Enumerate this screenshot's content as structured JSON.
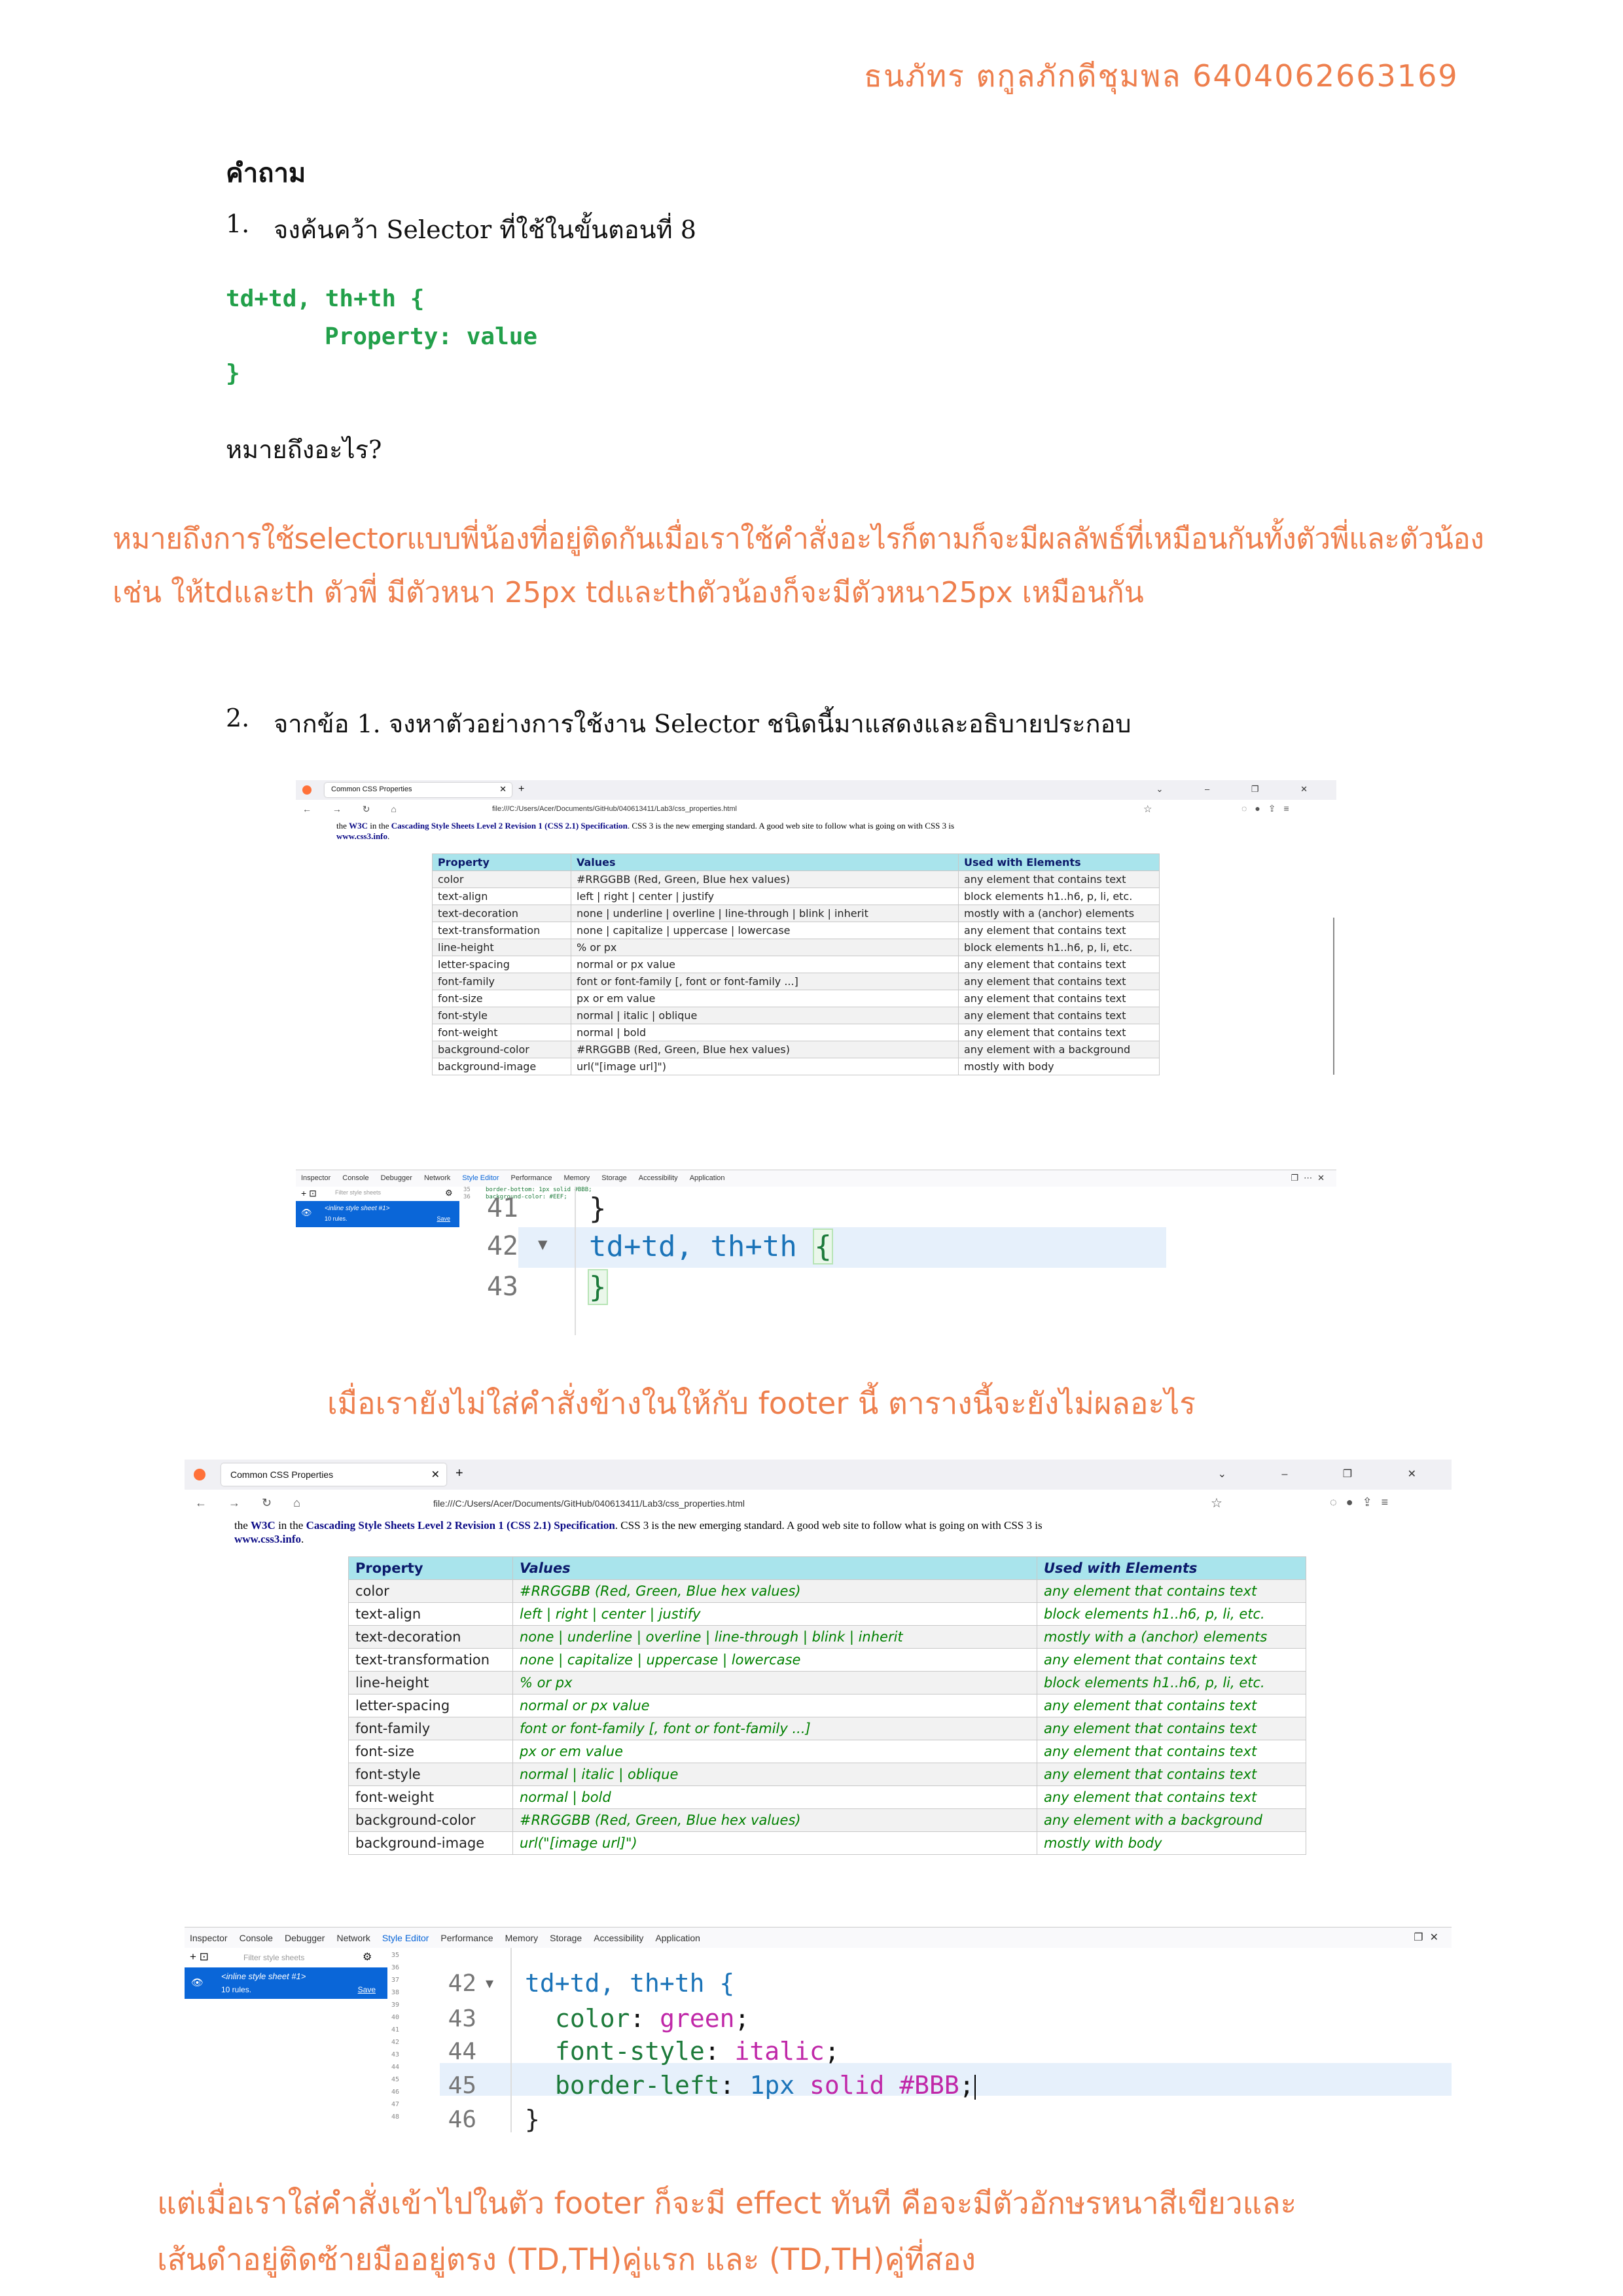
{
  "header": {
    "author": "ธนภัทร  ตกูลภักดีชุมพล 6404062663169"
  },
  "questions_heading": "คำถาม",
  "q1": {
    "number": "1.",
    "text": "จงค้นคว้า Selector ที่ใช้ในขั้นตอนที่ 8",
    "code_line1": "td+td, th+th {",
    "code_line2": "Property: value",
    "code_line3": "}",
    "ask": "หมายถึงอะไร?",
    "answer_line1": "หมายถึงการใช้selectorแบบพี่น้องที่อยู่ติดกันเมื่อเราใช้คำสั่งอะไรก็ตามก็จะมีผลลัพธ์ที่เหมือนกันทั้งตัวพี่และตัวน้อง",
    "answer_line2": "เช่น ให้tdและth ตัวพี่ มีตัวหนา 25px tdและthตัวน้องก็จะมีตัวหนา25px เหมือนกัน"
  },
  "q2": {
    "number": "2.",
    "text": "จากข้อ 1. จงหาตัวอย่างการใช้งาน Selector ชนิดนี้มาแสดงและอธิบายประกอบ"
  },
  "browser": {
    "tab_title": "Common CSS Properties",
    "new_tab": "+",
    "url": "file:///C:/Users/Acer/Documents/GitHub/040613411/Lab3/css_properties.html",
    "intro_pre": "the ",
    "intro_w3c": "W3C",
    "intro_mid": " in the ",
    "intro_spec": "Cascading Style Sheets Level 2 Revision 1 (CSS 2.1) Specification",
    "intro_post": ". CSS 3 is the new emerging standard. A good web site to follow what is going on with CSS 3 is",
    "intro_site": "www.css3.info",
    "intro_end": ".",
    "table_headers": [
      "Property",
      "Values",
      "Used with Elements"
    ],
    "table_rows": [
      [
        "color",
        "#RRGGBB (Red, Green, Blue hex values)",
        "any element that contains text"
      ],
      [
        "text-align",
        "left | right | center | justify",
        "block elements h1..h6, p, li, etc."
      ],
      [
        "text-decoration",
        "none | underline | overline | line-through | blink | inherit",
        "mostly with a (anchor) elements"
      ],
      [
        "text-transformation",
        "none | capitalize | uppercase | lowercase",
        "any element that contains text"
      ],
      [
        "line-height",
        "% or px",
        "block elements h1..h6, p, li, etc."
      ],
      [
        "letter-spacing",
        "normal or px value",
        "any element that contains text"
      ],
      [
        "font-family",
        "font or font-family [, font or font-family ...]",
        "any element that contains text"
      ],
      [
        "font-size",
        "px or em value",
        "any element that contains text"
      ],
      [
        "font-style",
        "normal | italic | oblique",
        "any element that contains text"
      ],
      [
        "font-weight",
        "normal | bold",
        "any element that contains text"
      ],
      [
        "background-color",
        "#RRGGBB (Red, Green, Blue hex values)",
        "any element with a background"
      ],
      [
        "background-image",
        "url(\"[image url]\")",
        "mostly with body"
      ]
    ],
    "devtools_tabs": [
      "Inspector",
      "Console",
      "Debugger",
      "Network",
      "Style Editor",
      "Performance",
      "Memory",
      "Storage",
      "Accessibility",
      "Application"
    ],
    "filter_placeholder": "Filter style sheets",
    "sheet_name": "<inline style sheet #1>",
    "sheet_rules": "10 rules.",
    "sheet_save": "Save"
  },
  "shot1": {
    "mini_lines": [
      "border-bottom: 1px solid #BBB;",
      "background-color: #EEF;"
    ],
    "mini_nums": [
      "35",
      "36"
    ],
    "line_nums": [
      "41",
      "42",
      "43"
    ],
    "line41": "}",
    "line42_selector": "td+td, th+th",
    "line42_brace": "{",
    "line43": "}"
  },
  "caption1": "เมื่อเรายังไม่ใส่คำสั่งข้างในให้กับ footer นี้ ตารางนี้จะยังไม่ผลอะไร",
  "shot2": {
    "mini_nums": [
      "35",
      "36",
      "37",
      "38",
      "39",
      "40",
      "41",
      "42",
      "43",
      "44",
      "45",
      "46",
      "47",
      "48"
    ],
    "line_nums": [
      "42",
      "43",
      "44",
      "45",
      "46"
    ],
    "line42": "td+td, th+th {",
    "l43_prop": "color",
    "l43_val": "green",
    "l44_prop": "font-style",
    "l44_val": "italic",
    "l45_prop": "border-left",
    "l45_val_num": "1px",
    "l45_val_kw": "solid",
    "l45_val_hex": "#BBB",
    "line46": "}"
  },
  "caption2_line1": "แต่เมื่อเราใส่คำสั่งเข้าไปในตัว footer ก็จะมี effect ทันที คือจะมีตัวอักษรหนาสีเขียวและ",
  "caption2_line2": "เส้นดำอยู่ติดซ้ายมืออยู่ตรง (TD,TH)คู่แรก และ (TD,TH)คู่ที่สอง"
}
